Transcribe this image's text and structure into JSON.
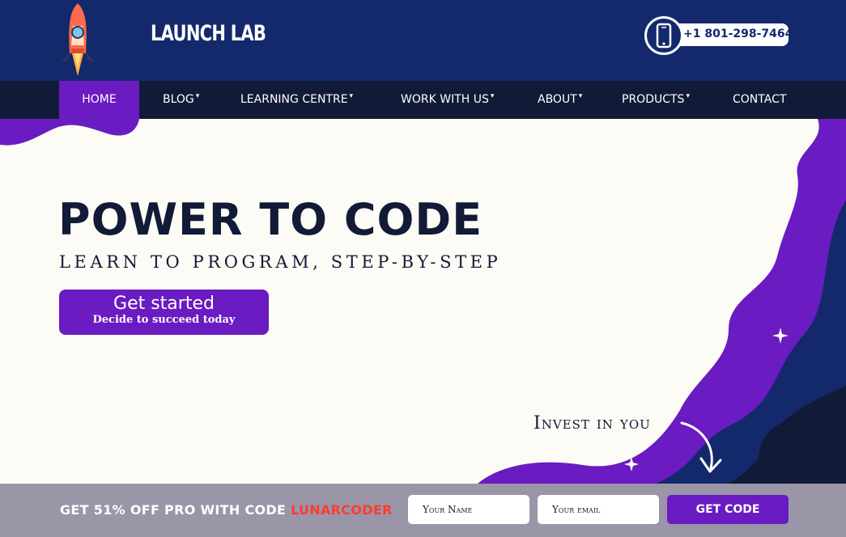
{
  "brand": {
    "name": "LAUNCH LAB"
  },
  "header": {
    "phone": "+1 801-298-7464"
  },
  "nav": {
    "items": [
      {
        "label": "HOME",
        "caret": ""
      },
      {
        "label": "BLOG",
        "caret": "▾"
      },
      {
        "label": "LEARNING CENTRE",
        "caret": "▾"
      },
      {
        "label": "WORK WITH US",
        "caret": "▾"
      },
      {
        "label": "ABOUT",
        "caret": "▾"
      },
      {
        "label": "PRODUCTS",
        "caret": "▾"
      },
      {
        "label": "CONTACT",
        "caret": ""
      }
    ]
  },
  "hero": {
    "title": "POWER TO CODE",
    "subtitle": "LEARN TO PROGRAM, STEP-BY-STEP",
    "cta_main": "Get started",
    "cta_sub": "Decide to succeed today",
    "tagline": "Invest in you"
  },
  "promo": {
    "text": "GET 51% OFF PRO WITH CODE",
    "code": "LUNARCODER",
    "name_placeholder": "Your Name",
    "email_placeholder": "Your email",
    "button_label": "GET CODE"
  },
  "colors": {
    "header_bg": "#13296b",
    "nav_bg": "#111a36",
    "accent_purple": "#6a1bc2",
    "promo_bg": "#9a96a8",
    "code_red": "#ff3b2f",
    "hero_bg": "#fdfbf5"
  },
  "icons": [
    "rocket-logo-icon",
    "smartphone-icon",
    "sparkle-icon",
    "curved-arrow-icon"
  ]
}
